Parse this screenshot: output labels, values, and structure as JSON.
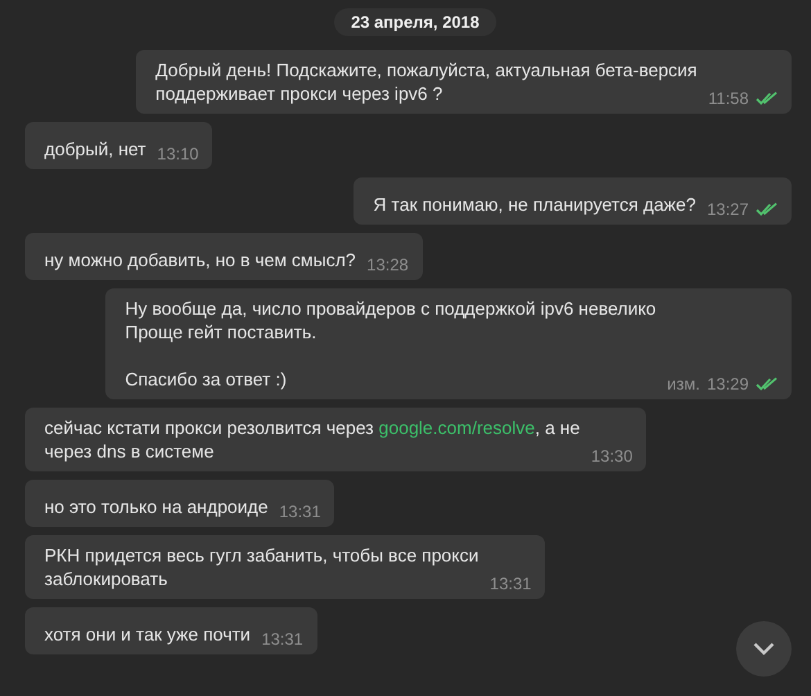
{
  "date_badge": "23 апреля, 2018",
  "messages": [
    {
      "outgoing": true,
      "segments": [
        {
          "kind": "plain",
          "text": "Добрый день! Подскажите, пожалуйста, актуальная бета-версия\nподдерживает прокси через ipv6 ?"
        }
      ],
      "time": "11:58",
      "read": true
    },
    {
      "outgoing": false,
      "segments": [
        {
          "kind": "plain",
          "text": "добрый, нет"
        }
      ],
      "time": "13:10"
    },
    {
      "outgoing": true,
      "segments": [
        {
          "kind": "plain",
          "text": "Я так понимаю, не планируется даже?"
        }
      ],
      "time": "13:27",
      "read": true
    },
    {
      "outgoing": false,
      "segments": [
        {
          "kind": "plain",
          "text": "ну можно добавить, но в чем смысл?"
        }
      ],
      "time": "13:28"
    },
    {
      "outgoing": true,
      "segments": [
        {
          "kind": "plain",
          "text": "Ну вообще да, число провайдеров с поддержкой ipv6 невелико\nПроще гейт поставить.\n\nСпасибо за ответ :)"
        }
      ],
      "edited": "изм.",
      "time": "13:29",
      "read": true
    },
    {
      "outgoing": false,
      "segments": [
        {
          "kind": "plain",
          "text": "сейчас кстати прокси резолвится через "
        },
        {
          "kind": "link",
          "text": "google.com/resolve"
        },
        {
          "kind": "plain",
          "text": ", а не\nчерез dns в системе"
        }
      ],
      "time": "13:30"
    },
    {
      "outgoing": false,
      "segments": [
        {
          "kind": "plain",
          "text": "но это только на андроиде"
        }
      ],
      "time": "13:31"
    },
    {
      "outgoing": false,
      "segments": [
        {
          "kind": "plain",
          "text": "РКН придется весь гугл забанить, чтобы все прокси\nзаблокировать"
        }
      ],
      "time": "13:31"
    },
    {
      "outgoing": false,
      "segments": [
        {
          "kind": "plain",
          "text": "хотя они и так уже почти"
        }
      ],
      "time": "13:31"
    }
  ]
}
